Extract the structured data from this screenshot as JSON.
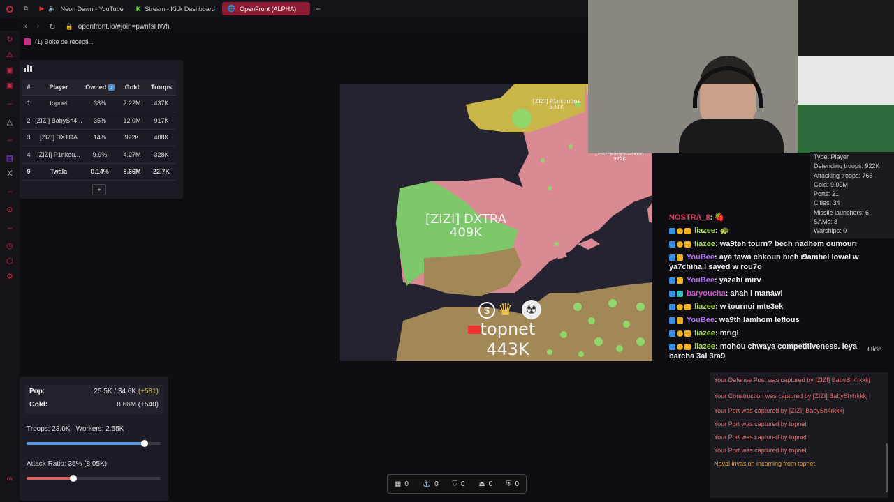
{
  "browser": {
    "tabs": [
      {
        "label": "Neon Dawn - YouTube",
        "icon": "youtube-icon"
      },
      {
        "label": "Stream - Kick Dashboard",
        "icon": "kick-icon"
      },
      {
        "label": "OpenFront (ALPHA)",
        "icon": "globe-icon",
        "active": true
      }
    ],
    "new_tab": "+",
    "url": "openfront.io/#join=pwnfsHWh",
    "bookmark": "(1) Boîte de récepti..."
  },
  "leaderboard": {
    "headers": [
      "#",
      "Player",
      "Owned",
      "Gold",
      "Troops"
    ],
    "rows": [
      {
        "rank": "1",
        "player": "topnet",
        "owned": "38%",
        "gold": "2.22M",
        "troops": "437K"
      },
      {
        "rank": "2",
        "player": "[ZIZI] BabySh4...",
        "owned": "35%",
        "gold": "12.0M",
        "troops": "917K"
      },
      {
        "rank": "3",
        "player": "[ZIZI] DXTRA",
        "owned": "14%",
        "gold": "922K",
        "troops": "408K"
      },
      {
        "rank": "4",
        "player": "[ZIZI] P1nkou...",
        "owned": "9.9%",
        "gold": "4.27M",
        "troops": "328K"
      },
      {
        "rank": "9",
        "player": "Twala",
        "owned": "0.14%",
        "gold": "8.66M",
        "troops": "22.7K"
      }
    ],
    "expand": "+"
  },
  "map": {
    "labels": {
      "dxtra_name": "[ZIZI] DXTRA",
      "dxtra_troops": "409K",
      "topnet_name": "topnet",
      "topnet_troops": "443K",
      "p1nk_name": "[ZIZI] P1nkoubee",
      "p1nk_troops": "331K",
      "baby_name": "[ZIZI] BabySh4rkkkj",
      "baby_troops": "922K"
    },
    "colors": {
      "sea": "#25232f",
      "pink": "#d98a92",
      "green": "#7cc86a",
      "tan": "#a28857",
      "yellow": "#c9b548"
    }
  },
  "player_info": {
    "lines": [
      "Type: Player",
      "Defending troops: 922K",
      "Attacking troops: 763",
      "Gold: 9.09M",
      "Ports: 21",
      "Cities: 34",
      "Missile launchers: 6",
      "SAMs: 8",
      "Warships: 0"
    ]
  },
  "chat": {
    "messages": [
      {
        "user": "NOSTRA_8",
        "text": ": 🍓",
        "color": "#e0405a"
      },
      {
        "user": "liazee",
        "text": ": 🐢",
        "color": "#a8d85a"
      },
      {
        "user": "liazee",
        "text": ": wa9teh tourn? bech nadhem oumouri",
        "color": "#a8d85a"
      },
      {
        "user": "YouBee",
        "text": ": aya tawa chkoun bich i9ambel lowel w ya7chiha l sayed w rou7o",
        "color": "#b070f0"
      },
      {
        "user": "YouBee",
        "text": ": yazebi mirv",
        "color": "#b070f0"
      },
      {
        "user": "baryoucha",
        "text": ": ahah l manawi",
        "color": "#d050d0"
      },
      {
        "user": "liazee",
        "text": ": w tournoi mte3ek",
        "color": "#a8d85a"
      },
      {
        "user": "YouBee",
        "text": ": wa9th lamhom leflous",
        "color": "#b070f0"
      },
      {
        "user": "liazee",
        "text": ": mrigl",
        "color": "#a8d85a"
      },
      {
        "user": "liazee",
        "text": ": mohou chwaya competitiveness. leya barcha 3al 3ra9",
        "color": "#a8d85a"
      }
    ]
  },
  "events": {
    "hide": "Hide",
    "items": [
      "Your Defense Post was captured by [ZIZI] BabySh4rkkkj",
      "Your Construction was captured by [ZIZI] BabySh4rkkkj",
      "Your Port was captured by [ZIZI] BabySh4rkkkj",
      "Your Port was captured by topnet",
      "Your Port was captured by topnet",
      "Your Port was captured by topnet"
    ],
    "naval": "Naval invasion incoming from topnet"
  },
  "stats": {
    "pop_label": "Pop:",
    "pop_value": "25.5K / 34.6K",
    "pop_delta": "(+581)",
    "gold_label": "Gold:",
    "gold_value": "8.66M (+540)",
    "troops_line": "Troops: 23.0K | Workers: 2.55K",
    "troops_ratio": 0.88,
    "attack_line": "Attack Ratio: 35% (8.05K)",
    "attack_ratio": 0.35
  },
  "bottombar": {
    "items": [
      {
        "icon": "city-icon",
        "value": "0"
      },
      {
        "icon": "anchor-icon",
        "value": "0"
      },
      {
        "icon": "shield-icon",
        "value": "0"
      },
      {
        "icon": "missile-icon",
        "value": "0"
      },
      {
        "icon": "sam-icon",
        "value": "0"
      }
    ]
  }
}
